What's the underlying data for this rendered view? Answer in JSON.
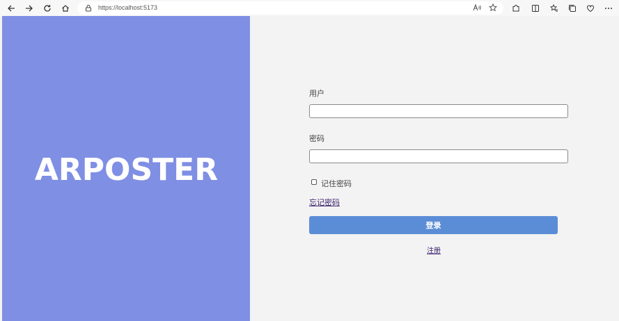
{
  "browser": {
    "url": "https://localhost:5173",
    "icons": {
      "back": "back-arrow-icon",
      "forward": "forward-arrow-icon",
      "refresh": "refresh-icon",
      "home": "home-icon",
      "lock": "lock-icon",
      "read_aloud": "read-aloud-icon",
      "favorite": "star-icon",
      "extensions": "extensions-icon",
      "split": "split-screen-icon",
      "favorites": "favorites-icon",
      "collections": "collections-icon",
      "health": "browser-essentials-icon",
      "more": "more-icon"
    }
  },
  "brand": {
    "name": "ARPOSTER",
    "color": "#7f8fe4"
  },
  "form": {
    "username_label": "用户",
    "username_value": "",
    "password_label": "密码",
    "password_value": "",
    "remember_label": "记住密码",
    "remember_checked": false,
    "forgot_link": "忘记密码",
    "login_button": "登录",
    "login_button_color": "#5b8dd6",
    "register_link": "注册"
  }
}
